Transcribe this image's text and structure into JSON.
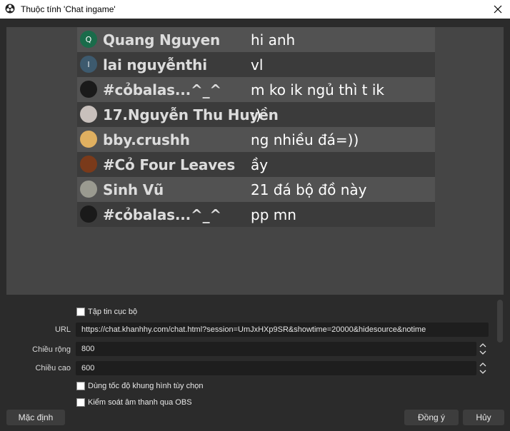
{
  "window": {
    "title": "Thuộc tính 'Chat ingame'",
    "obs_icon": "obs-logo-icon",
    "close_icon": "close-icon"
  },
  "chat": {
    "messages": [
      {
        "avatar_text": "Q",
        "avatar_color": "#1a6b4a",
        "username": "Quang Nguyen",
        "message": "hi anh"
      },
      {
        "avatar_text": "l",
        "avatar_color": "#3d5a6e",
        "username": "lai nguyễnthi",
        "message": "vl"
      },
      {
        "avatar_text": "",
        "avatar_color": "#1a1a1a",
        "username": "#cỏbalas...^_^",
        "message": "m ko ik ngủ thì t ik"
      },
      {
        "avatar_text": "",
        "avatar_color": "#c8c0bc",
        "username": "17.Nguyễn Thu Huyền",
        "message": ":)"
      },
      {
        "avatar_text": "",
        "avatar_color": "#e0b060",
        "username": "bby.crushh",
        "message": "ng nhiều đá=))"
      },
      {
        "avatar_text": "",
        "avatar_color": "#7a3a1a",
        "username": "#Cỏ Four Leaves",
        "message": "ầy"
      },
      {
        "avatar_text": "",
        "avatar_color": "#9a9a90",
        "username": "Sinh Vũ",
        "message": "21 đá bộ đồ này"
      },
      {
        "avatar_text": "",
        "avatar_color": "#1a1a1a",
        "username": "#cỏbalas...^_^",
        "message": "pp mn"
      }
    ]
  },
  "properties": {
    "local_file_label": "Tập tin cục bộ",
    "local_file_checked": false,
    "url_label": "URL",
    "url_value": "https://chat.khanhhy.com/chat.html?session=UmJxHXp9SR&showtime=20000&hidesource&notime",
    "width_label": "Chiều rộng",
    "width_value": "800",
    "height_label": "Chiều cao",
    "height_value": "600",
    "custom_fps_label": "Dùng tốc độ khung hình tùy chọn",
    "custom_fps_checked": false,
    "control_audio_label": "Kiểm soát âm thanh qua OBS",
    "control_audio_checked": false
  },
  "buttons": {
    "defaults": "Mặc định",
    "ok": "Đồng ý",
    "cancel": "Hủy"
  }
}
